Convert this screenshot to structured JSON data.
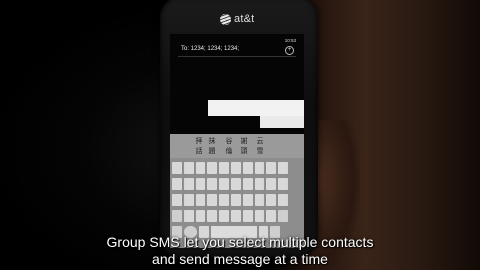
{
  "phone": {
    "carrier_logo": "at&t",
    "status_time": "10:53",
    "recipients": "To: 1234; 1234; 1234;",
    "add_icon": "plus-circle-icon",
    "candidates": [
      "拝",
      "抹",
      "谷",
      "謝",
      "云"
    ],
    "candidate_sub": [
      "話",
      "題",
      "倫",
      "頭",
      "雪"
    ]
  },
  "caption": {
    "line1": "Group SMS let you select multiple contacts",
    "line2": "and send message at a time"
  }
}
